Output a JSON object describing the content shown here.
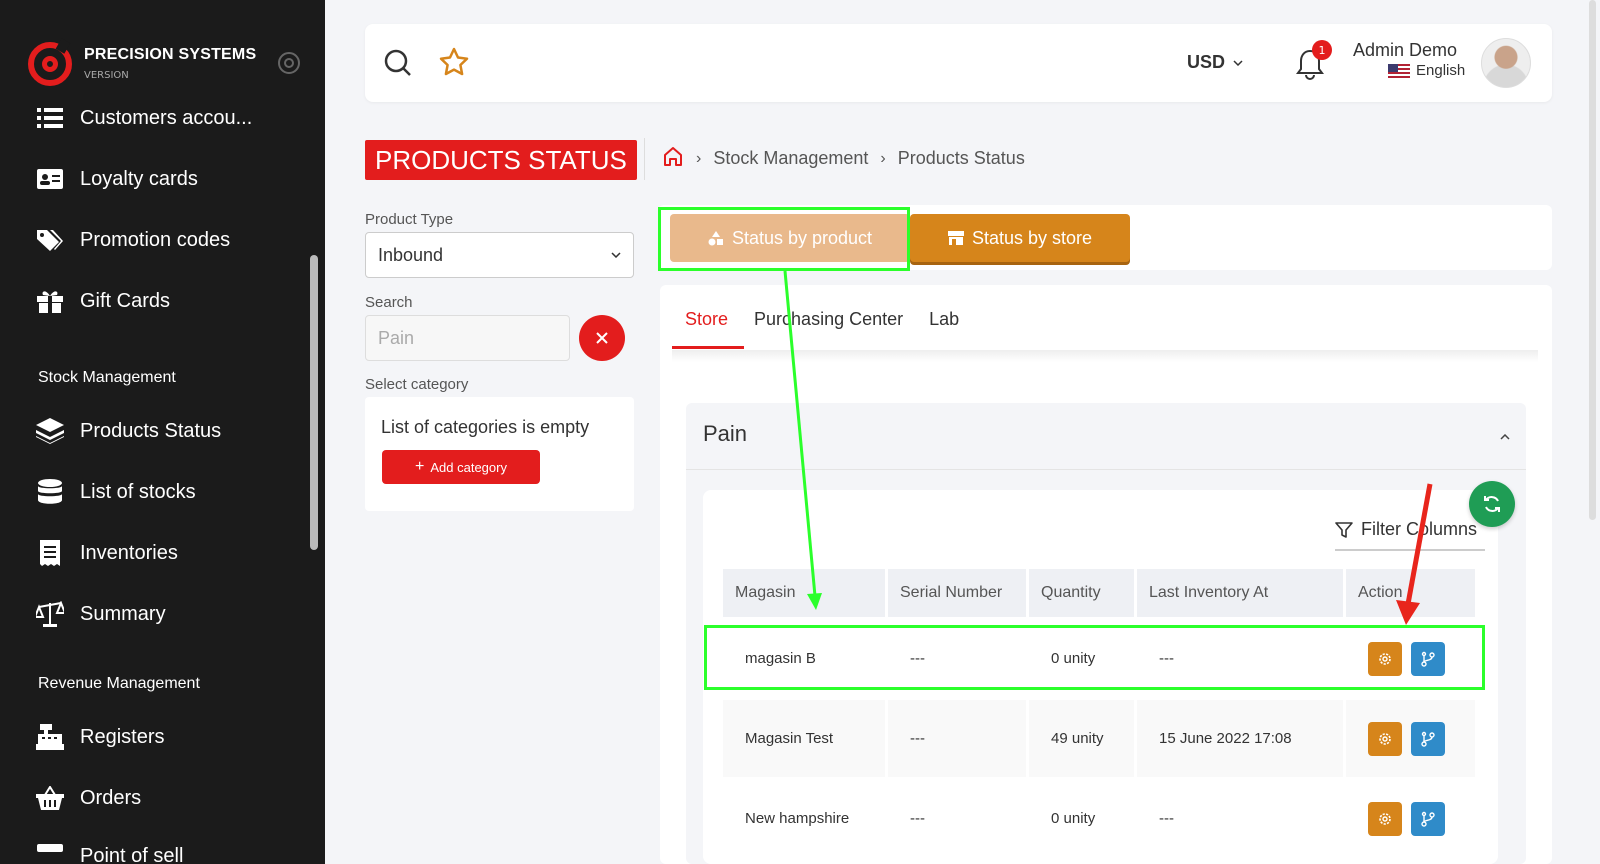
{
  "brand": {
    "name": "PRECISION SYSTEMS",
    "sub": "VERSION"
  },
  "sidebar": {
    "items": [
      {
        "label": "Customers accou...",
        "icon": "list-icon"
      },
      {
        "label": "Loyalty cards",
        "icon": "id-card-icon"
      },
      {
        "label": "Promotion codes",
        "icon": "tags-icon"
      },
      {
        "label": "Gift Cards",
        "icon": "gift-icon"
      },
      {
        "label": "Products Status",
        "icon": "layers-icon"
      },
      {
        "label": "List of stocks",
        "icon": "database-icon"
      },
      {
        "label": "Inventories",
        "icon": "receipt-icon"
      },
      {
        "label": "Summary",
        "icon": "balance-scale-icon"
      },
      {
        "label": "Registers",
        "icon": "cash-register-icon"
      },
      {
        "label": "Orders",
        "icon": "basket-icon"
      },
      {
        "label": "Point of sell",
        "icon": "store-icon"
      }
    ],
    "sections": {
      "stock": "Stock Management",
      "revenue": "Revenue Management"
    }
  },
  "topbar": {
    "currency": "USD",
    "notification_count": "1",
    "user_name": "Admin Demo",
    "language": "English"
  },
  "page": {
    "title": "PRODUCTS STATUS",
    "breadcrumb": [
      "Stock Management",
      "Products Status"
    ]
  },
  "filters": {
    "product_type_label": "Product Type",
    "product_type_value": "Inbound",
    "search_label": "Search",
    "search_value": "Pain",
    "category_label": "Select category",
    "category_empty": "List of categories is empty",
    "add_category": "Add category"
  },
  "status_buttons": {
    "by_product": "Status by product",
    "by_store": "Status by store"
  },
  "tabs": [
    "Store",
    "Purchasing Center",
    "Lab"
  ],
  "accordion": {
    "title": "Pain"
  },
  "table": {
    "filter_columns": "Filter Columns",
    "columns": [
      "Magasin",
      "Serial Number",
      "Quantity",
      "Last Inventory At",
      "Action"
    ],
    "rows": [
      {
        "magasin": "magasin B",
        "serial": "---",
        "quantity": "0 unity",
        "last_inventory": "---"
      },
      {
        "magasin": "Magasin Test",
        "serial": "---",
        "quantity": "49 unity",
        "last_inventory": "15 June 2022 17:08"
      },
      {
        "magasin": "New hampshire",
        "serial": "---",
        "quantity": "0 unity",
        "last_inventory": "---"
      }
    ]
  },
  "colors": {
    "brand_red": "#e31d1d",
    "orange": "#d6851b",
    "light_orange": "#e9b98c",
    "blue": "#2f8bc9",
    "green": "#1f9d55",
    "annotation_green": "#2bff2b",
    "annotation_red": "#e8251c"
  }
}
